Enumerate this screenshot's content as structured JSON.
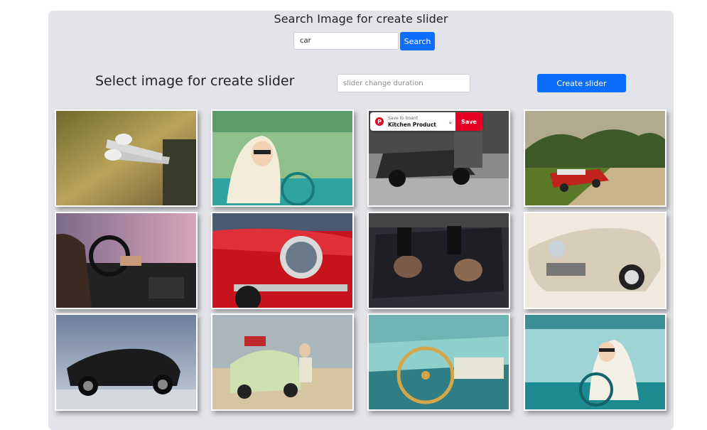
{
  "search": {
    "title": "Search Image for create slider",
    "query": "car",
    "button_label": "Search"
  },
  "slider": {
    "title": "Select image for create slider",
    "duration_placeholder": "slider change duration",
    "create_button_label": "Create slider"
  },
  "pinterest": {
    "save_to_board_label": "Save to board",
    "board_name": "Kitchen Product",
    "save_label": "Save"
  },
  "gallery": {
    "images": [
      {
        "subject": "legs-sneakers-car-window"
      },
      {
        "subject": "woman-headscarf-driving-convertible"
      },
      {
        "subject": "couple-vintage-car-bw"
      },
      {
        "subject": "red-classic-car-dirt-road"
      },
      {
        "subject": "driver-hands-steering-wheel"
      },
      {
        "subject": "red-car-headlight-closeup"
      },
      {
        "subject": "women-lying-on-car-hood"
      },
      {
        "subject": "white-classic-cadillac"
      },
      {
        "subject": "black-mustang-dramatic-sky"
      },
      {
        "subject": "woman-beetle-beach"
      },
      {
        "subject": "vintage-car-interior-dashboard"
      },
      {
        "subject": "woman-driving-teal-convertible"
      }
    ]
  }
}
